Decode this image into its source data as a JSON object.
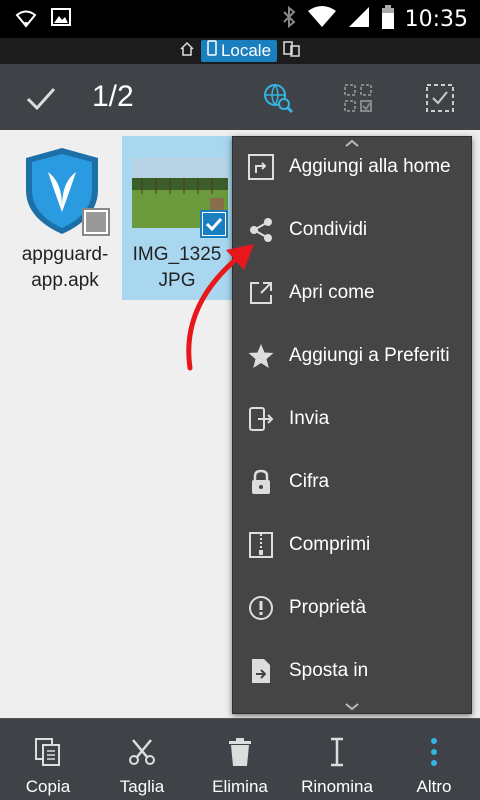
{
  "statusbar": {
    "time": "10:35"
  },
  "pathbar": {
    "location": "Locale"
  },
  "actionbar": {
    "selection_count": "1/2"
  },
  "files": [
    {
      "name": "appguard-app.apk",
      "line1": "appguard-",
      "line2": "app.apk",
      "selected": false
    },
    {
      "name": "IMG_1325.JPG",
      "line1": "IMG_1325",
      "line2": "JPG",
      "selected": true
    }
  ],
  "menu": {
    "items": [
      {
        "label": "Aggiungi alla home",
        "icon": "add-to-home-icon"
      },
      {
        "label": "Condividi",
        "icon": "share-icon"
      },
      {
        "label": "Apri come",
        "icon": "open-as-icon"
      },
      {
        "label": "Aggiungi a Preferiti",
        "icon": "star-icon"
      },
      {
        "label": "Invia",
        "icon": "send-icon"
      },
      {
        "label": "Cifra",
        "icon": "lock-icon"
      },
      {
        "label": "Comprimi",
        "icon": "zip-icon"
      },
      {
        "label": "Proprietà",
        "icon": "info-icon"
      },
      {
        "label": "Sposta in",
        "icon": "move-to-icon"
      }
    ]
  },
  "bottombar": {
    "copy": "Copia",
    "cut": "Taglia",
    "delete": "Elimina",
    "rename": "Rinomina",
    "more": "Altro"
  },
  "colors": {
    "accent": "#1a7fbf",
    "selection": "#a9d7ef",
    "menu_bg": "#454545",
    "toolbar_bg": "#3f4246",
    "more_icon": "#33b5e5",
    "annotation_arrow": "#e8171b"
  }
}
